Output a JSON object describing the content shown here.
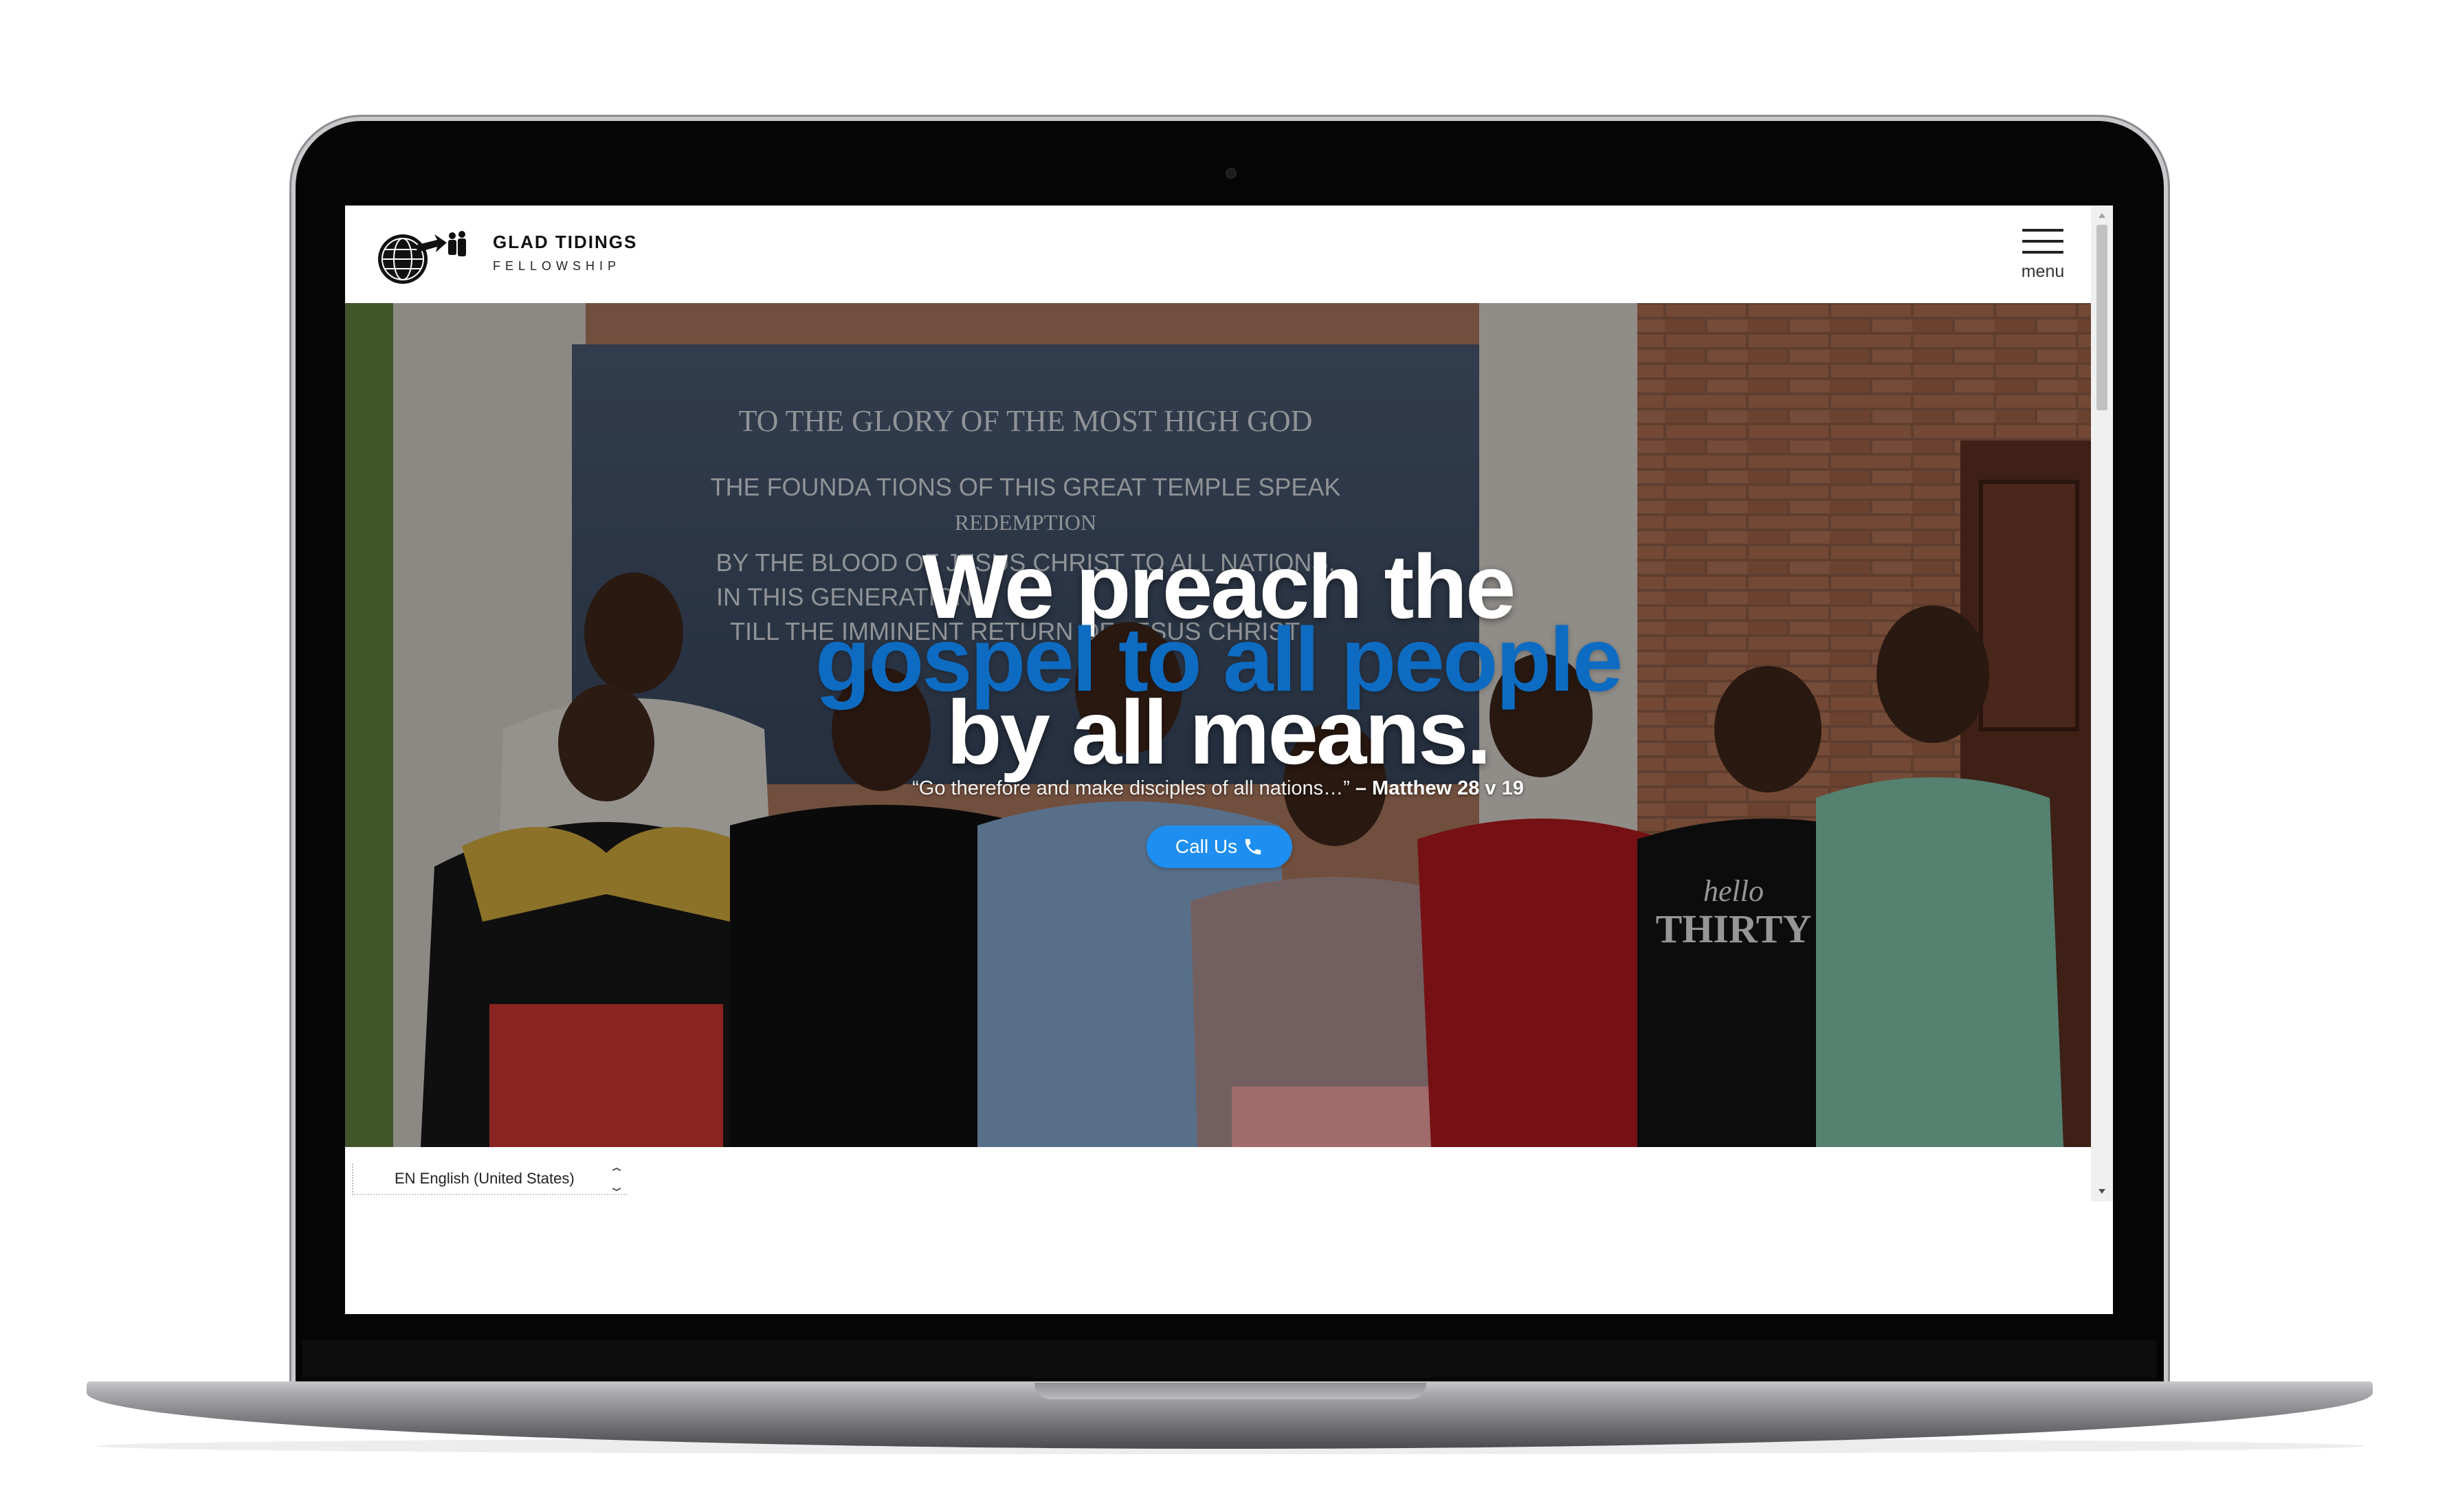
{
  "header": {
    "brand_name": "GLAD TIDINGS",
    "brand_sub": "FELLOWSHIP",
    "menu_label": "menu"
  },
  "hero": {
    "line1": "We preach the",
    "line2": "gospel to all people",
    "line3": "by all means.",
    "quote_text": "“Go therefore and make disciples of all nations…” ",
    "quote_ref": "– Matthew 28 v 19",
    "call_label": "Call Us",
    "plaque": {
      "title": "TO THE GLORY OF THE MOST HIGH GOD",
      "line1": "THE FOUNDA TIONS OF THIS GREAT TEMPLE SPEAK",
      "line2": "REDEMPTION",
      "line3": "BY THE BLOOD OF JESUS CHRIST TO ALL NATIONS,",
      "line4": "IN THIS GENERATION",
      "line5": "TILL THE IMMINENT RETURN OF JESUS CHRIST"
    },
    "shirt_text1": "hello",
    "shirt_text2": "THIRTY"
  },
  "language": {
    "label": "EN English (United States)"
  },
  "colors": {
    "accent": "#0d6cc2",
    "button": "#1e8ef0"
  },
  "icons": {
    "logo": "globe-with-people-logo",
    "menu": "hamburger-icon",
    "call": "phone-icon"
  }
}
